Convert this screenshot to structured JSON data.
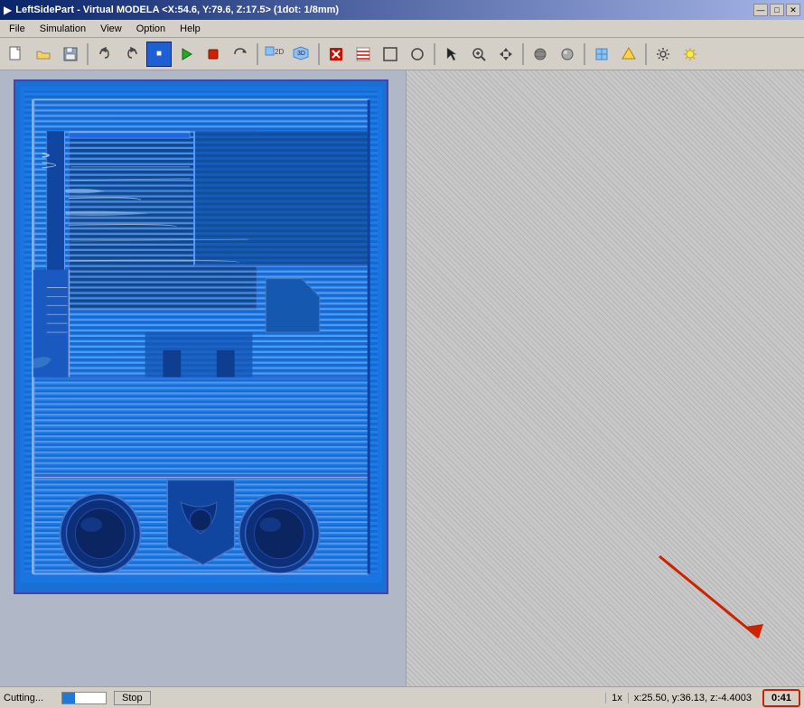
{
  "window": {
    "title": "LeftSidePart - Virtual MODELA <X:54.6, Y:79.6, Z:17.5> (1dot: 1/8mm)",
    "icon": "▶"
  },
  "controls": {
    "minimize": "—",
    "maximize": "□",
    "close": "✕"
  },
  "menu": {
    "items": [
      "File",
      "Simulation",
      "View",
      "Option",
      "Help"
    ]
  },
  "toolbar": {
    "buttons": [
      {
        "name": "new",
        "icon": "📄"
      },
      {
        "name": "open",
        "icon": "📂"
      },
      {
        "name": "save",
        "icon": "💾"
      },
      {
        "name": "undo",
        "icon": "↩"
      },
      {
        "name": "redo",
        "icon": "↪"
      },
      {
        "name": "play",
        "icon": "▶"
      },
      {
        "name": "stop-tool",
        "icon": "■"
      },
      {
        "name": "rotate",
        "icon": "⟳"
      },
      {
        "name": "view3d",
        "icon": "3D"
      },
      {
        "name": "view-front",
        "icon": "F"
      },
      {
        "name": "view-side",
        "icon": "S"
      },
      {
        "name": "red-arrow",
        "icon": "➤"
      },
      {
        "name": "color",
        "icon": "🎨"
      },
      {
        "name": "grid",
        "icon": "⊞"
      },
      {
        "name": "circle",
        "icon": "○"
      },
      {
        "name": "tool1",
        "icon": "⬡"
      },
      {
        "name": "tool2",
        "icon": "◈"
      },
      {
        "name": "tool3",
        "icon": "◉"
      },
      {
        "name": "tool4",
        "icon": "⊙"
      },
      {
        "name": "tool5",
        "icon": "◎"
      },
      {
        "name": "settings",
        "icon": "⚙"
      },
      {
        "name": "light",
        "icon": "☀"
      }
    ]
  },
  "status": {
    "cutting_label": "Cutting...",
    "stop_label": "Stop",
    "scale": "1x",
    "coords": "x:25.50, y:36.13, z:-4.4003",
    "time": "0:41"
  }
}
